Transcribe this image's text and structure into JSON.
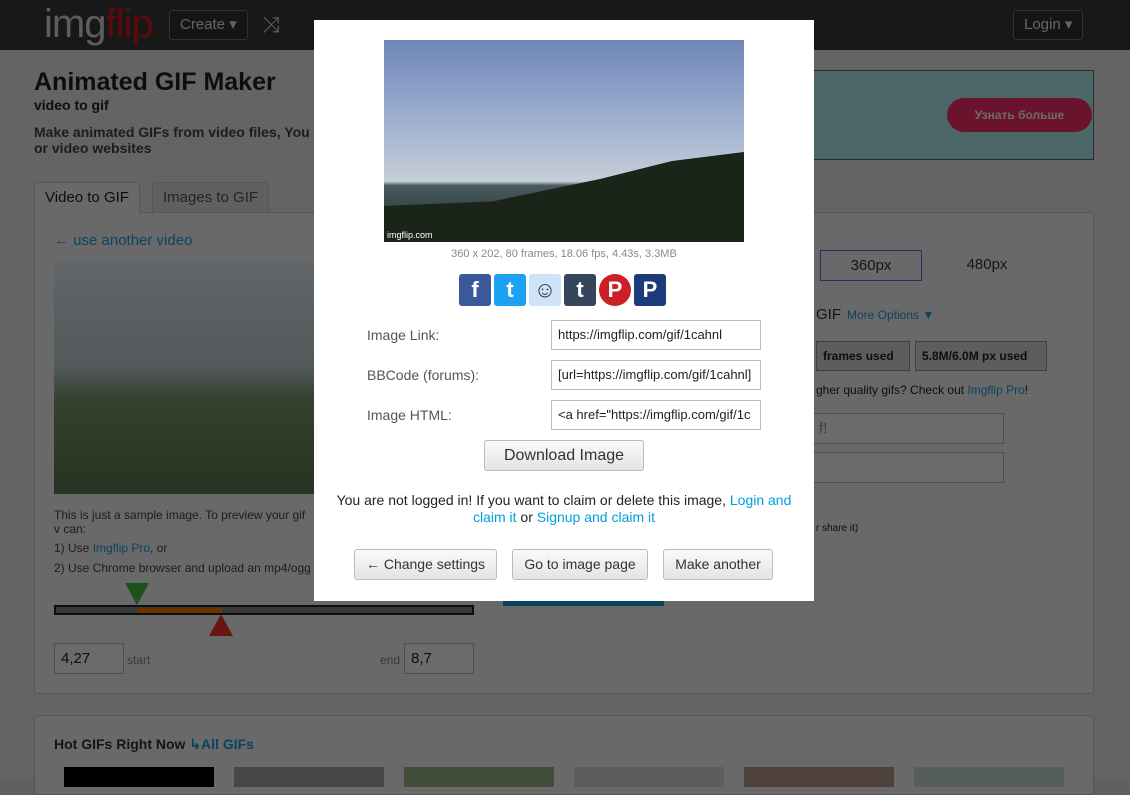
{
  "header": {
    "logo_a": "img",
    "logo_b": "flip",
    "create": "Create ▾",
    "login": "Login ▾",
    "shuffle_icon": "shuffle-icon"
  },
  "page": {
    "title": "Animated GIF Maker",
    "subtitle": "video to gif",
    "description": "Make animated GIFs from video files, You or video websites"
  },
  "ad": {
    "button": "Узнать больше"
  },
  "tabs": [
    {
      "label": "Video to GIF",
      "active": true
    },
    {
      "label": "Images to GIF",
      "active": false
    }
  ],
  "left": {
    "back_link": "← use another video",
    "sample_note": "This is just a sample image. To preview your gif v can:",
    "opt1_prefix": "1) Use ",
    "opt1_link": "Imgflip Pro",
    "opt1_suffix": ", or",
    "opt2": "2) Use Chrome browser and upload an mp4/ogg",
    "start_value": "4,27",
    "start_label": "start",
    "end_label": "end",
    "end_value": "8,7"
  },
  "right": {
    "size_selected": "360px",
    "size_other": "480px",
    "gif_label": "GIF",
    "more_options": "More Options ▼",
    "frames_used": "frames used",
    "px_used": "5.8M/6.0M px used",
    "pro_text": "gher quality gifs? Check out ",
    "pro_link": "Imgflip Pro",
    "pro_end": "!",
    "title_placeholder": "f!",
    "share_note": "r share it)"
  },
  "hot": {
    "title": "Hot GIFs Right Now",
    "all_link": "↳All GIFs"
  },
  "modal": {
    "watermark": "imgflip.com",
    "caption": "360 x 202, 80 frames, 18.06 fps, 4.43s, 3.3MB",
    "share": [
      {
        "name": "facebook",
        "glyph": "f",
        "color": "#3b5998"
      },
      {
        "name": "twitter",
        "glyph": "t",
        "color": "#1da1f2"
      },
      {
        "name": "reddit",
        "glyph": "☺",
        "color": "#cee3f8"
      },
      {
        "name": "tumblr",
        "glyph": "t",
        "color": "#35465c"
      },
      {
        "name": "pinterest",
        "glyph": "P",
        "color": "#cb2027"
      },
      {
        "name": "pinterest-alt",
        "glyph": "P",
        "color": "#1c3b7a"
      }
    ],
    "fields": [
      {
        "label": "Image Link:",
        "value": "https://imgflip.com/gif/1cahnl"
      },
      {
        "label": "BBCode (forums):",
        "value": "[url=https://imgflip.com/gif/1cahnl]"
      },
      {
        "label": "Image HTML:",
        "value": "<a href=\"https://imgflip.com/gif/1c"
      }
    ],
    "download": "Download Image",
    "notice_text": "You are not logged in! If you want to claim or delete this image, ",
    "notice_login": "Login and claim it",
    "notice_or": " or ",
    "notice_signup": "Signup and claim it",
    "buttons": {
      "change": "← Change settings",
      "goto": "Go to image page",
      "another": "Make another"
    }
  }
}
